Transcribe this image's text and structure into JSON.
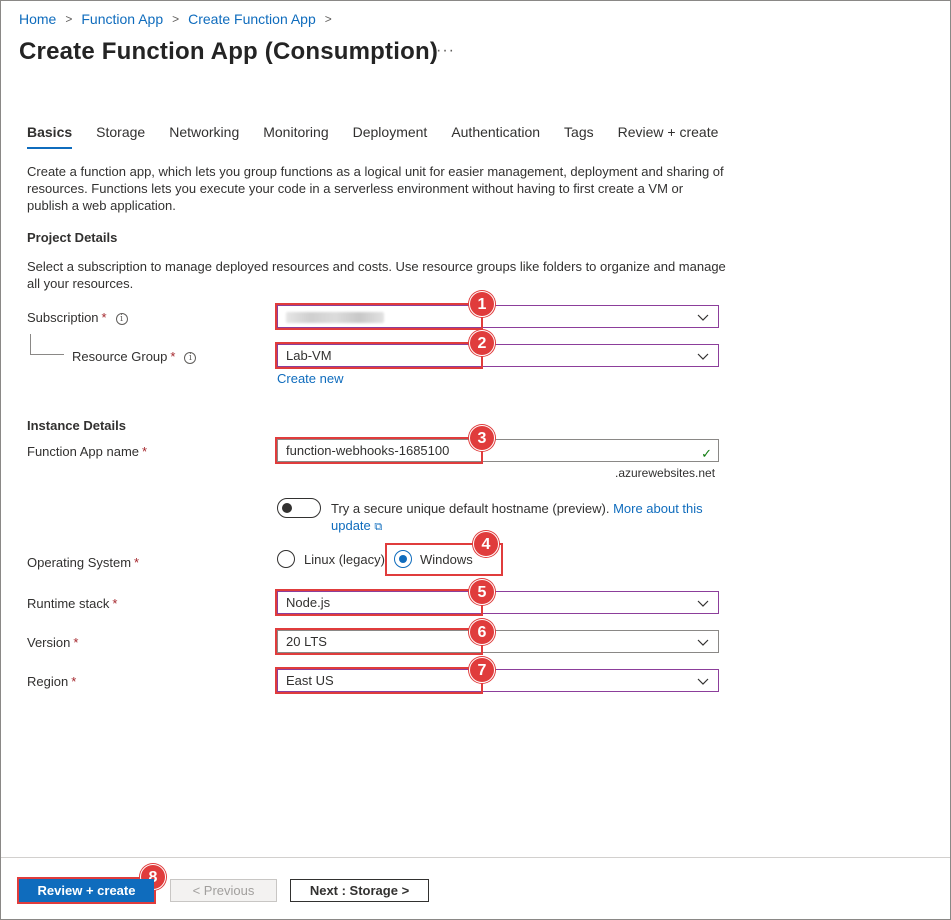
{
  "breadcrumb": [
    "Home",
    "Function App",
    "Create Function App"
  ],
  "title": "Create Function App (Consumption)",
  "more_icon": "···",
  "tabs": [
    "Basics",
    "Storage",
    "Networking",
    "Monitoring",
    "Deployment",
    "Authentication",
    "Tags",
    "Review + create"
  ],
  "intro": "Create a function app, which lets you group functions as a logical unit for easier management, deployment and sharing of resources. Functions lets you execute your code in a serverless environment without having to first create a VM or publish a web application.",
  "project": {
    "heading": "Project Details",
    "desc": "Select a subscription to manage deployed resources and costs. Use resource groups like folders to organize and manage all your resources.",
    "subscription_label": "Subscription",
    "resource_group_label": "Resource Group",
    "resource_group_value": "Lab-VM",
    "create_new": "Create new"
  },
  "instance": {
    "heading": "Instance Details",
    "name_label": "Function App name",
    "name_value": "function-webhooks-1685100",
    "domain_suffix": ".azurewebsites.net",
    "hostname_text": "Try a secure unique default hostname (preview).",
    "hostname_link_1": "More about this",
    "hostname_link_2": "update",
    "os_label": "Operating System",
    "os_linux": "Linux (legacy)",
    "os_windows": "Windows",
    "os_selected": "Windows",
    "runtime_label": "Runtime stack",
    "runtime_value": "Node.js",
    "version_label": "Version",
    "version_value": "20 LTS",
    "region_label": "Region",
    "region_value": "East US"
  },
  "required_mark": "*",
  "info_glyph": "i",
  "check_glyph": "✓",
  "ext_link_glyph": "⧉",
  "badges": [
    "1",
    "2",
    "3",
    "4",
    "5",
    "6",
    "7",
    "8"
  ],
  "footer": {
    "review_create": "Review + create",
    "previous": "< Previous",
    "next": "Next : Storage >"
  },
  "colors": {
    "accent": "#0f6cbd",
    "annotation": "#e03c3c",
    "required": "#a4262c",
    "field_focus": "#8c3e9b",
    "valid": "#107c10"
  }
}
